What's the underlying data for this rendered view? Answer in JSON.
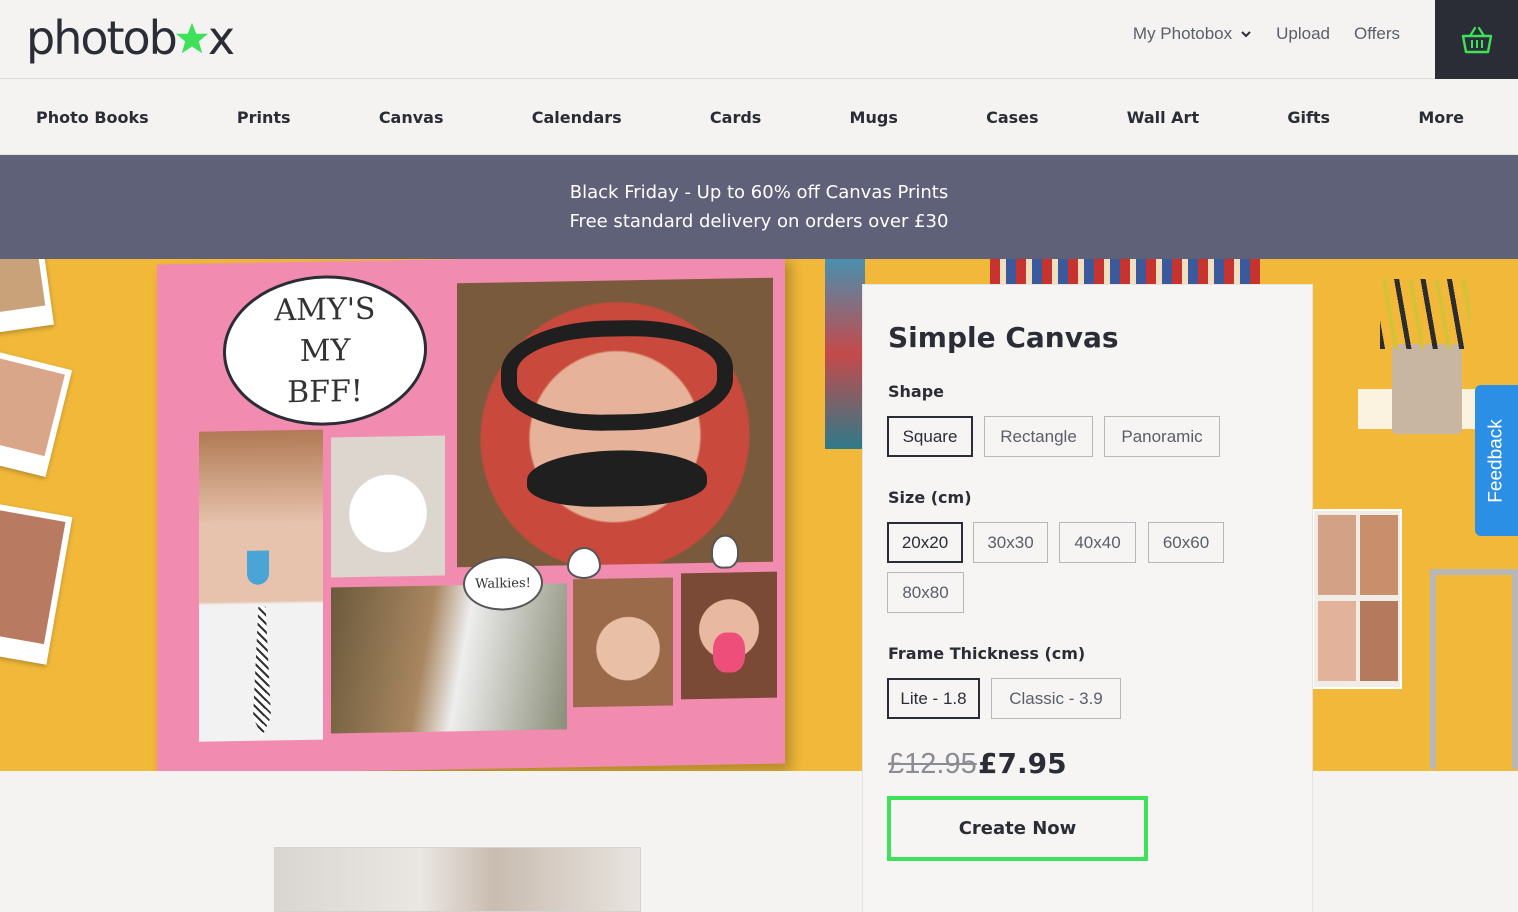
{
  "header": {
    "logo_text_left": "photob",
    "logo_text_right": "x",
    "links": [
      {
        "label": "My Photobox",
        "has_dropdown": true
      },
      {
        "label": "Upload"
      },
      {
        "label": "Offers"
      }
    ],
    "basket_icon": "basket-icon"
  },
  "nav": {
    "items": [
      "Photo Books",
      "Prints",
      "Canvas",
      "Calendars",
      "Cards",
      "Mugs",
      "Cases",
      "Wall Art",
      "Gifts",
      "More"
    ]
  },
  "promo": {
    "line1": "Black Friday - Up to 60% off Canvas Prints",
    "line2": "Free standard delivery on orders over £30"
  },
  "hero": {
    "speech_text": "AMY'S MY BFF!",
    "thought_text": "Walkies!"
  },
  "product": {
    "title": "Simple Canvas",
    "shape_label": "Shape",
    "shapes": [
      "Square",
      "Rectangle",
      "Panoramic"
    ],
    "selected_shape": "Square",
    "size_label": "Size (cm)",
    "sizes": [
      "20x20",
      "30x30",
      "40x40",
      "60x60",
      "80x80"
    ],
    "selected_size": "20x20",
    "frame_label": "Frame Thickness (cm)",
    "frames": [
      "Lite - 1.8",
      "Classic - 3.9"
    ],
    "selected_frame": "Lite - 1.8",
    "price_old": "£12.95",
    "price_new": "£7.95",
    "cta": "Create Now"
  },
  "feedback_label": "Feedback",
  "colors": {
    "brand_dark": "#2b2d36",
    "brand_green": "#3ee25a",
    "promo_bg": "#5f6179",
    "feedback_blue": "#2b8fe5",
    "hero_yellow": "#f1b83a"
  }
}
